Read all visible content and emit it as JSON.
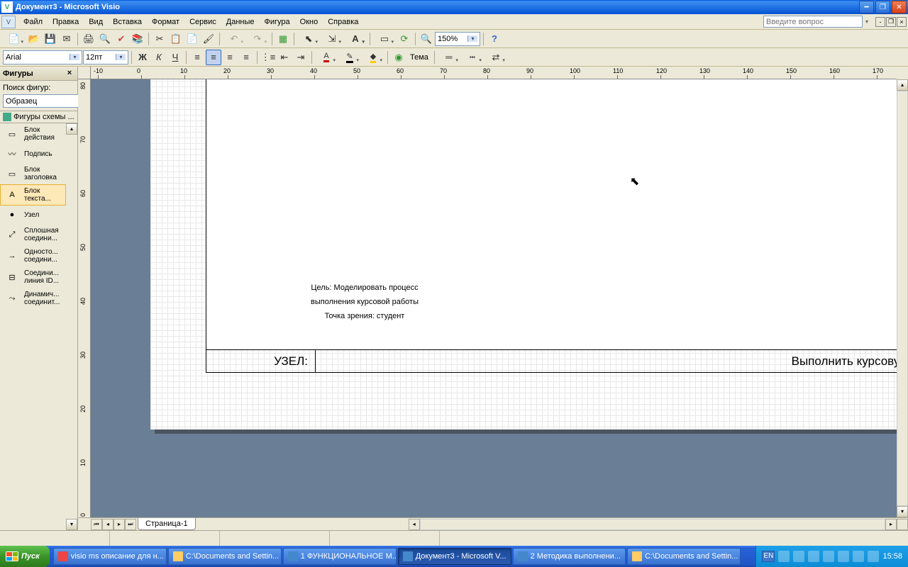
{
  "title": "Документ3 - Microsoft Visio",
  "menu": [
    "Файл",
    "Правка",
    "Вид",
    "Вставка",
    "Формат",
    "Сервис",
    "Данные",
    "Фигура",
    "Окно",
    "Справка"
  ],
  "help_placeholder": "Введите вопрос",
  "zoom": "150%",
  "font_name": "Arial",
  "font_size": "12пт",
  "theme_label": "Тема",
  "shapes_panel": {
    "title": "Фигуры",
    "search_label": "Поиск фигур:",
    "search_value": "Образец",
    "stencil": "Фигуры схемы ...",
    "items": [
      {
        "label": "Блок действия"
      },
      {
        "label": "Подпись"
      },
      {
        "label": "Блок заголовка"
      },
      {
        "label": "Блок текста..."
      },
      {
        "label": "Узел"
      },
      {
        "label": "Сплошная соедини..."
      },
      {
        "label": "Односто... соедини..."
      },
      {
        "label": "Соедини... линия ID..."
      },
      {
        "label": "Динамич... соединит..."
      }
    ]
  },
  "ruler_h": [
    "-10",
    "0",
    "10",
    "20",
    "30",
    "40",
    "50",
    "60",
    "70",
    "80",
    "90",
    "100",
    "110",
    "120",
    "130",
    "140",
    "150",
    "160",
    "170"
  ],
  "ruler_v": [
    "80",
    "70",
    "60",
    "50",
    "40",
    "30",
    "20",
    "10",
    "0"
  ],
  "diagram": {
    "text_l1": "Цель: Моделировать процесс",
    "text_l2": "выполнения курсовой работы",
    "text_l3": "Точка зрения: студент",
    "footer_node": "УЗЕЛ:",
    "footer_title": "Выполнить курсовую работу"
  },
  "page_tab": "Страница-1",
  "taskbar": {
    "start": "Пуск",
    "items": [
      {
        "label": "visio ms описание для н...",
        "ico": "#e44"
      },
      {
        "label": "C:\\Documents and Settin...",
        "ico": "#fc6"
      },
      {
        "label": "1 ФУНКЦИОНАЛЬНОЕ М...",
        "ico": "#48c"
      },
      {
        "label": "Документ3 - Microsoft V...",
        "ico": "#48c",
        "active": true
      },
      {
        "label": "2 Методика выполнени...",
        "ico": "#48c"
      },
      {
        "label": "C:\\Documents and Settin...",
        "ico": "#fc6"
      }
    ],
    "lang": "EN",
    "clock": "15:58"
  }
}
